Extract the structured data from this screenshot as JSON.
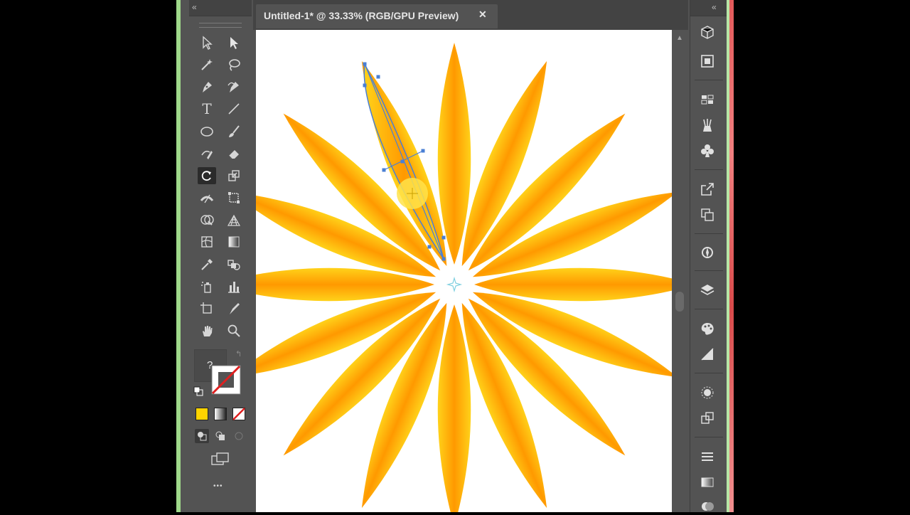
{
  "document_tab": {
    "title": "Untitled-1* @ 33.33% (RGB/GPU Preview)",
    "close_glyph": "✕"
  },
  "toolbar": {
    "collapse_glyph": "«",
    "more_glyph": "•••",
    "unknown_glyph": "?",
    "tools": [
      "selection-tool",
      "direct-selection-tool",
      "magic-wand-tool",
      "lasso-tool",
      "pen-tool",
      "curvature-tool",
      "type-tool",
      "line-segment-tool",
      "ellipse-tool",
      "paintbrush-tool",
      "shaper-tool",
      "eraser-tool",
      "rotate-tool",
      "scale-tool",
      "width-tool",
      "free-transform-tool",
      "shape-builder-tool",
      "perspective-grid-tool",
      "mesh-tool",
      "gradient-tool",
      "eyedropper-tool",
      "blend-tool",
      "symbol-sprayer-tool",
      "column-graph-tool",
      "artboard-tool",
      "slice-tool",
      "hand-tool",
      "zoom-tool"
    ],
    "selected_tool": "rotate-tool",
    "fill_color": "#ffffff",
    "stroke": "none",
    "color_mode_color": "#ffd400"
  },
  "right_panel": {
    "collapse_glyph": "«",
    "icons": [
      "libraries-icon",
      "properties-icon",
      "swatches-icon",
      "brushes-icon",
      "symbols-icon",
      "export-icon",
      "artboards-icon",
      "navigator-icon",
      "layers-icon",
      "color-icon",
      "color-guide-icon",
      "appearance-icon",
      "transform-icon",
      "align-icon",
      "gradient-icon",
      "transparency-icon"
    ]
  },
  "artwork": {
    "petal_count": 16,
    "petal_light_color": "#ffd21a",
    "petal_dark_color": "#ff9900",
    "selection_color": "#4a7fd4",
    "center_marker_color": "#7fd0e0"
  }
}
